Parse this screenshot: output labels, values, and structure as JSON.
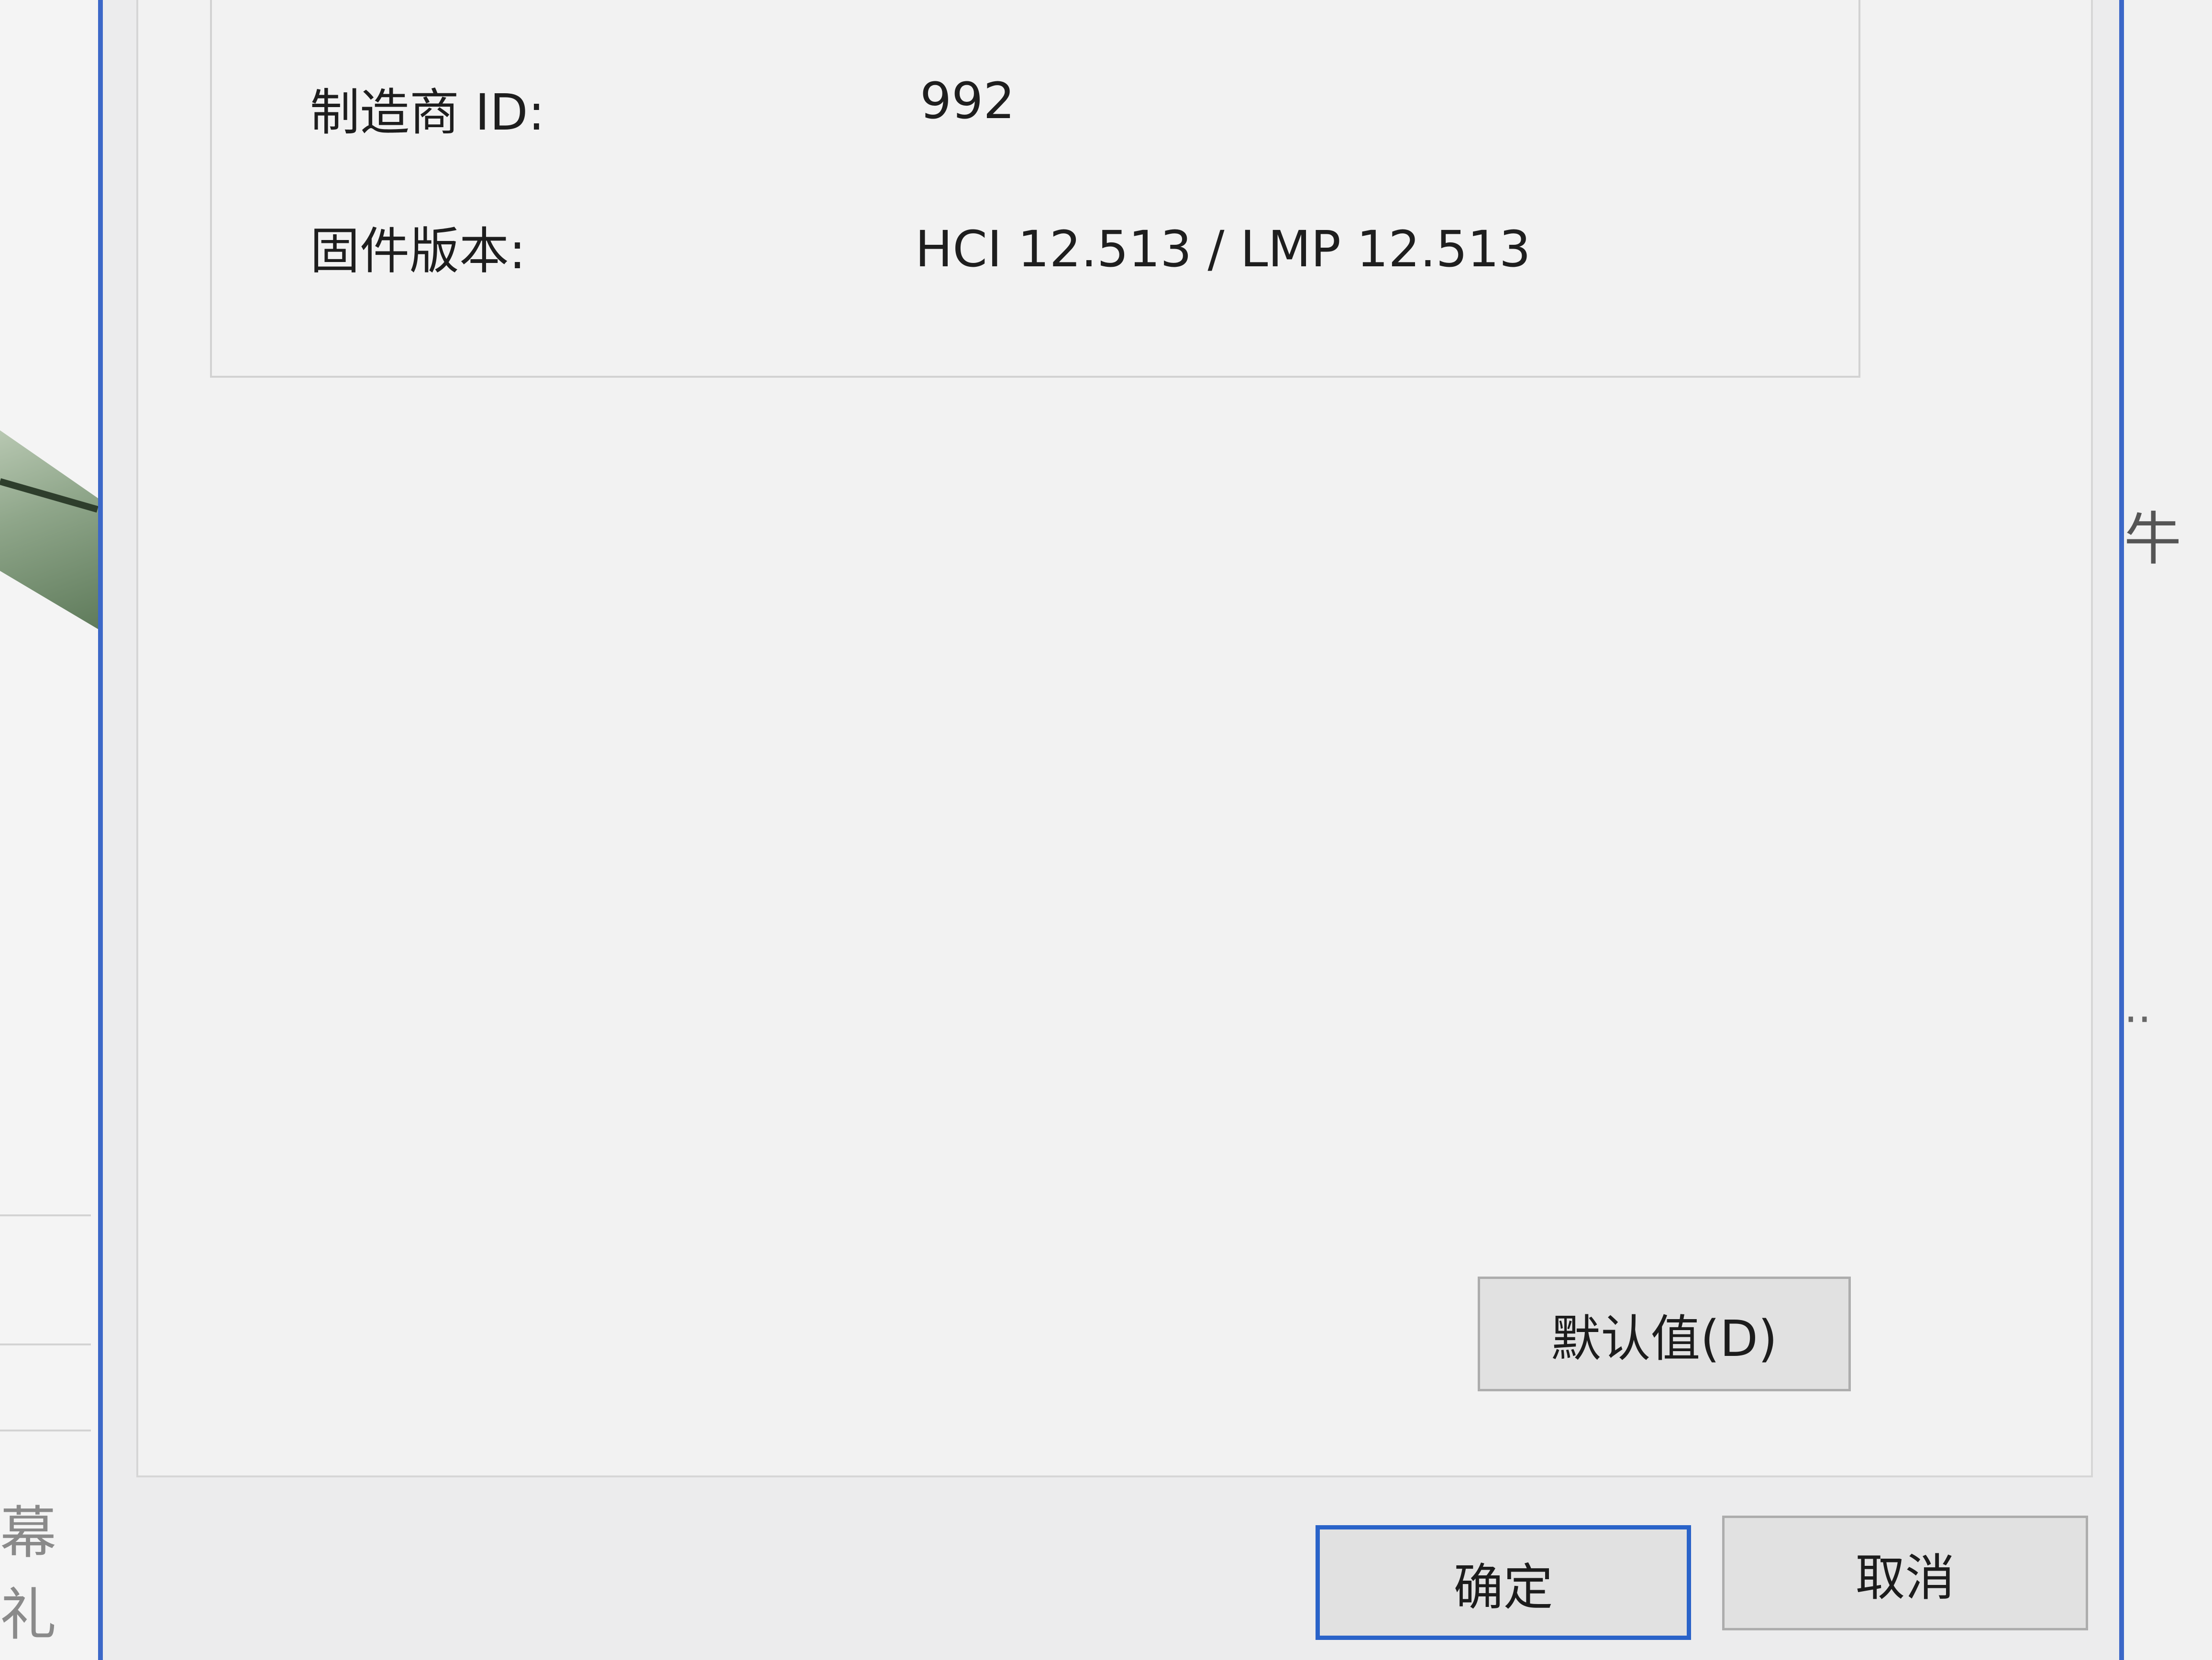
{
  "background": {
    "left_glyphs": "幕礼",
    "right_glyph": "牛",
    "right_dots": "··"
  },
  "properties": {
    "manufacturer_id": {
      "label": "制造商 ID:",
      "value": "992"
    },
    "firmware_version": {
      "label": "固件版本:",
      "value": "HCI 12.513  /  LMP 12.513"
    }
  },
  "buttons": {
    "defaults": "默认值(D)",
    "ok": "确定",
    "cancel": "取消"
  },
  "colors": {
    "accent": "#2a63c9",
    "dialog_background": "#ececed",
    "panel_background": "#f2f2f2"
  }
}
